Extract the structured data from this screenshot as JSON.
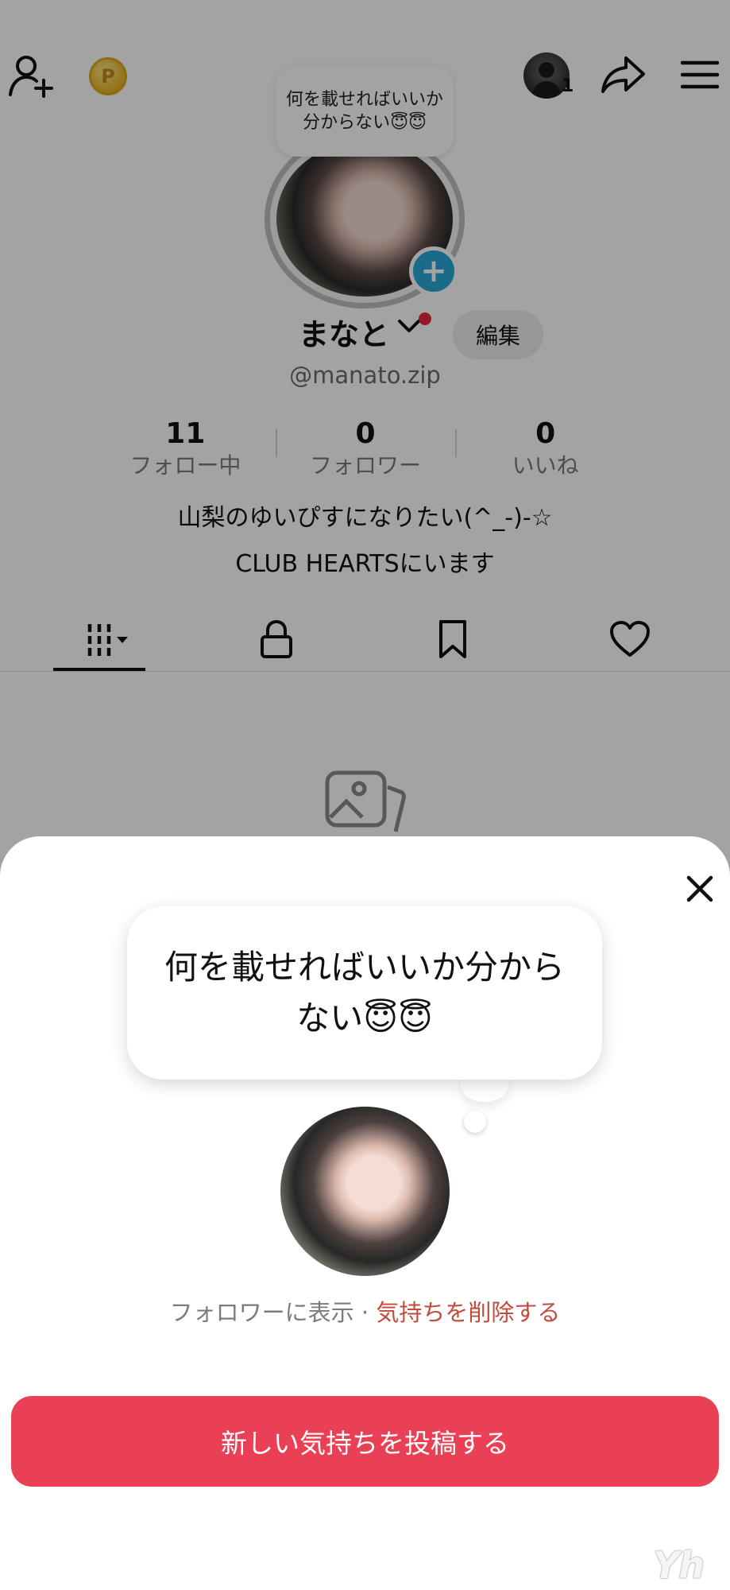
{
  "header": {
    "icons": [
      "add-friend-icon",
      "coin-icon",
      "share-icon",
      "menu-icon"
    ],
    "coin_symbol": "P",
    "notification_count": "1"
  },
  "profile": {
    "status_bubble": "何を載せればいいか分からない😇😇",
    "avatar_badge": "+",
    "username": "まなと",
    "edit_label": "編集",
    "handle": "@manato.zip",
    "stats": [
      {
        "value": "11",
        "label": "フォロー中"
      },
      {
        "value": "0",
        "label": "フォロワー"
      },
      {
        "value": "0",
        "label": "いいね"
      }
    ],
    "bio_lines": [
      "山梨のゆいぴすになりたい(^_-)-☆",
      "CLUB HEARTSにいます"
    ],
    "tabs": [
      "videos-tab-icon",
      "lock-icon",
      "bookmark-icon",
      "heart-icon"
    ]
  },
  "sheet": {
    "bubble_text": "何を載せればいいか分からない😇😇",
    "visibility_text": "フォロワーに表示 · ",
    "delete_link": "気持ちを削除する",
    "post_button": "新しい気持ちを投稿する"
  },
  "colors": {
    "accent": "#ea4055",
    "danger_link": "#c44a3e",
    "badge_blue": "#2aa7d8",
    "notification_dot": "#e1293f"
  },
  "watermark": "Yh"
}
